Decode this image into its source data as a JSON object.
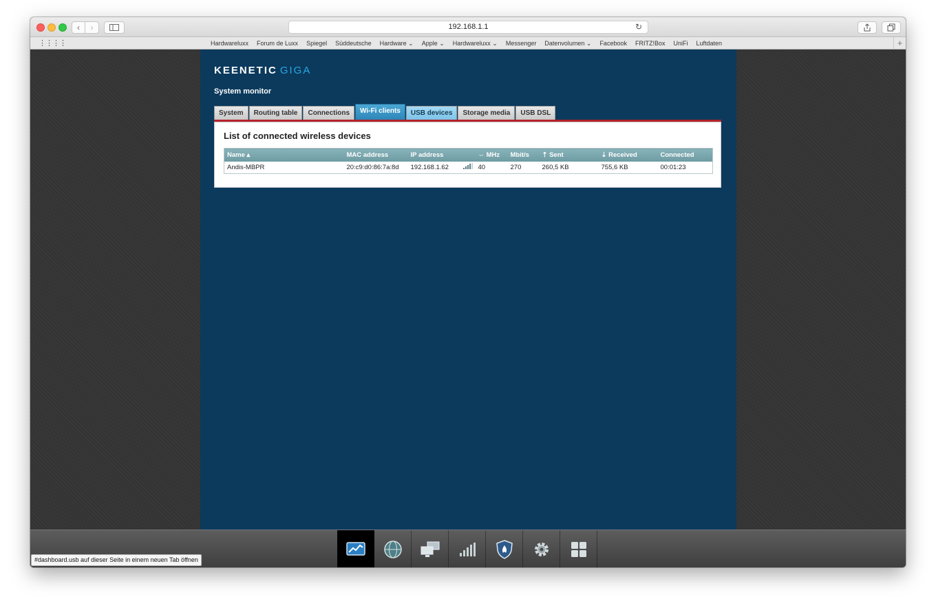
{
  "browser": {
    "url": "192.168.1.1",
    "bookmarks": [
      "Hardwareluxx",
      "Forum de Luxx",
      "Spiegel",
      "Süddeutsche",
      "Hardware ⌄",
      "Apple ⌄",
      "Hardwareluxx ⌄",
      "Messenger",
      "Datenvolumen ⌄",
      "Facebook",
      "FRITZ!Box",
      "UniFi",
      "Luftdaten"
    ],
    "status_link": "#dashboard.usb auf dieser Seite in einem neuen Tab öffnen"
  },
  "router": {
    "logo_main": "KEENETIC",
    "logo_sub": "GIGA",
    "page_title": "System monitor",
    "tabs": [
      "System",
      "Routing table",
      "Connections",
      "Wi-Fi clients",
      "USB devices",
      "Storage media",
      "USB DSL"
    ],
    "active_tab": "Wi-Fi clients",
    "section_title": "List of connected wireless devices",
    "columns": {
      "name": "Name ▴",
      "mac": "MAC address",
      "ip": "IP address",
      "mhz": "⇔ MHz",
      "mbits": "Mbit/s",
      "sent": "⇡ Sent",
      "received": "⇣ Received",
      "connected": "Connected"
    },
    "clients": [
      {
        "name": "Andis-MBPR",
        "mac": "20:c9:d0:86:7a:8d",
        "ip": "192.168.1.62",
        "signal_bars": 4,
        "mhz": "40",
        "mbits": "270",
        "sent": "260,5 KB",
        "received": "755,6 KB",
        "connected": "00:01:23"
      }
    ]
  },
  "dock": {
    "items": [
      "monitor-icon",
      "internet-globe-icon",
      "home-network-icon",
      "wifi-signal-icon",
      "firewall-shield-icon",
      "settings-gear-icon",
      "apps-grid-icon"
    ]
  },
  "colors": {
    "panel_bg": "#0b3a5d",
    "active_tab": "#2d86b8",
    "tab_rule": "#b5222b",
    "logo_accent": "#2aa7e0"
  }
}
